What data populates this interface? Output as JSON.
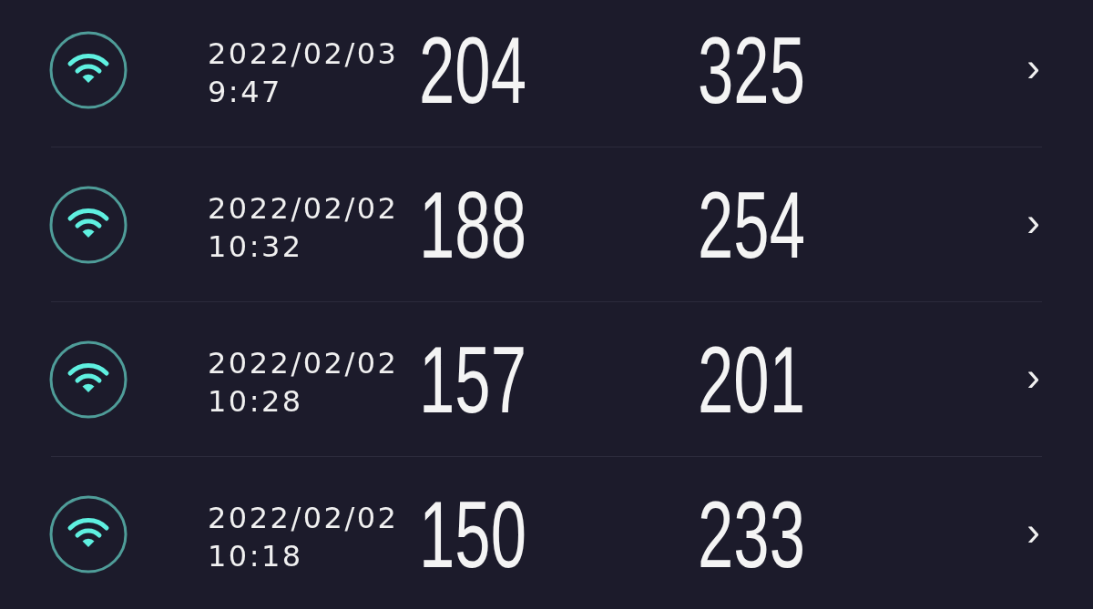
{
  "rows": [
    {
      "date": "2022/02/03",
      "time": "9:47",
      "column_3": "204",
      "column_4": "325",
      "chevron": "›"
    },
    {
      "date": "2022/02/02",
      "time": "10:32",
      "column_3": "188",
      "column_4": "254",
      "chevron": "›"
    },
    {
      "date": "2022/02/02",
      "time": "10:28",
      "column_3": "157",
      "column_4": "201",
      "chevron": "›"
    },
    {
      "date": "2022/02/02",
      "time": "10:18",
      "column_3": "150",
      "column_4": "233",
      "chevron": "›"
    }
  ]
}
